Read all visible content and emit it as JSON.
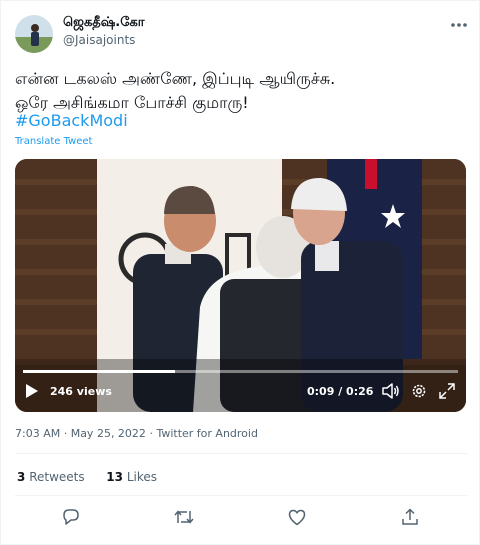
{
  "user": {
    "display_name": "ஜெகதீஷ்.கோ",
    "handle": "@Jaisajoints"
  },
  "tweet": {
    "line1": "என்ன டகலஸ் அண்ணே, இப்புடி ஆயிருச்சு.",
    "line2": "ஒரே அசிங்கமா போச்சி குமாரு!",
    "hashtag": "#GoBackModi",
    "translate_label": "Translate Tweet",
    "timestamp": "7:03 AM · May 25, 2022",
    "client": "Twitter for Android",
    "retweets_count": "3",
    "retweets_label": "Retweets",
    "likes_count": "13",
    "likes_label": "Likes"
  },
  "video": {
    "views": "246 views",
    "time": "0:09 / 0:26",
    "progress_fraction": 0.35
  },
  "icons": {
    "more": "more-icon",
    "play": "play-icon",
    "volume": "volume-icon",
    "settings": "settings-icon",
    "fullscreen": "fullscreen-icon",
    "reply": "reply-icon",
    "retweet": "retweet-icon",
    "like": "like-icon",
    "share": "share-icon"
  },
  "colors": {
    "accent": "#1d9bf0",
    "secondary_text": "#536471",
    "primary_text": "#0f1419"
  }
}
